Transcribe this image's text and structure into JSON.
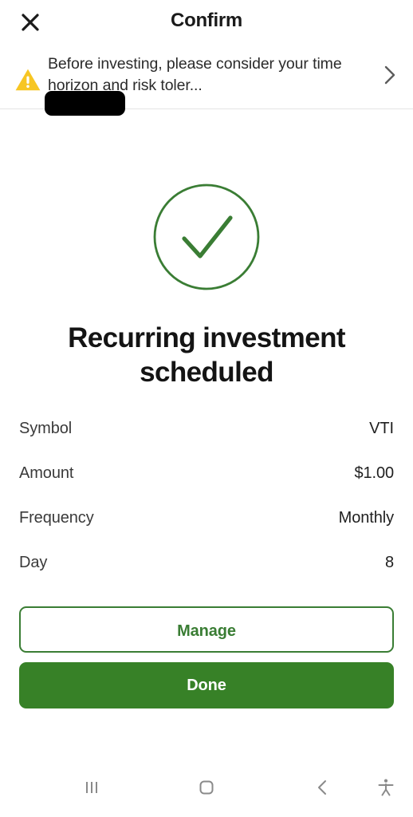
{
  "header": {
    "title": "Confirm",
    "close_icon": "close-icon"
  },
  "banner": {
    "icon": "warning-triangle-icon",
    "text": "Before investing, please consider your time horizon and risk toler...",
    "redacted": true,
    "chevron_icon": "chevron-right-icon",
    "warning_color": "#F7C623"
  },
  "status": {
    "icon": "check-circle-icon",
    "accent_color": "#3A7D34",
    "title": "Recurring investment scheduled"
  },
  "details": {
    "rows": [
      {
        "label": "Symbol",
        "value": "VTI"
      },
      {
        "label": "Amount",
        "value": "$1.00"
      },
      {
        "label": "Frequency",
        "value": "Monthly"
      },
      {
        "label": "Day",
        "value": "8"
      }
    ]
  },
  "actions": {
    "manage_label": "Manage",
    "done_label": "Done",
    "primary_color": "#378127",
    "secondary_border_color": "#3A7D34"
  },
  "navbar": {
    "recent_icon": "recent-apps-icon",
    "home_icon": "home-icon",
    "back_icon": "back-icon",
    "accessibility_icon": "accessibility-icon",
    "icon_color": "#8a8a8a"
  }
}
